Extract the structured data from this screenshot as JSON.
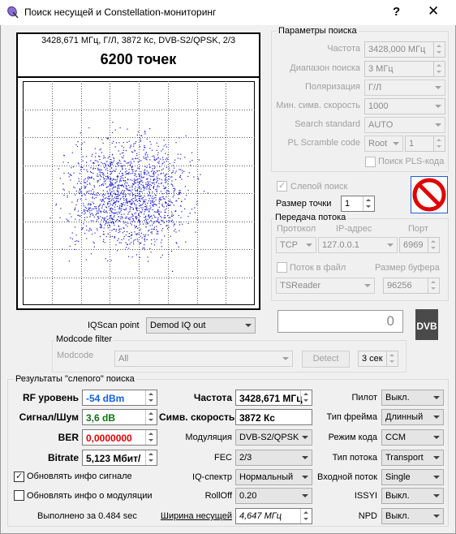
{
  "window": {
    "title": "Поиск несущей и Constellation-мониторинг",
    "help_label": "?",
    "close_label": "✕"
  },
  "plot": {
    "header": "3428,671 МГц, Г/Л, 3872 Кс, DVB-S2/QPSK, 2/3",
    "count": "6200 точек",
    "point_color": "#1a1ad0"
  },
  "search_params": {
    "title": "Параметры поиска",
    "frequency": {
      "label": "Частота",
      "value": "3428,000 МГц"
    },
    "range": {
      "label": "Диапазон поиска",
      "value": "3 МГц"
    },
    "polarization": {
      "label": "Поляризация",
      "value": "Г/Л"
    },
    "min_symrate": {
      "label": "Мин. симв. скорость",
      "value": "1000"
    },
    "standard": {
      "label": "Search standard",
      "value": "AUTO"
    },
    "pls": {
      "label": "PL Scramble code",
      "mode": "Root",
      "value": "1"
    },
    "pls_search": {
      "label": "Поиск PLS-кода",
      "checked": false
    }
  },
  "blind": {
    "label": "Слепой поиск",
    "checked": true,
    "point_size_label": "Размер точки",
    "point_size": "1"
  },
  "stream": {
    "title": "Передача потока",
    "protocol_label": "Протокол",
    "ip_label": "IP-адрес",
    "port_label": "Порт",
    "protocol": "TCP",
    "ip": "127.0.0.1",
    "port": "6969",
    "to_file": {
      "label": "Поток в файл",
      "checked": false
    },
    "buffer_label": "Размер буфера",
    "reader": "TSReader",
    "buffer": "96256"
  },
  "iq": {
    "label": "IQScan point",
    "value": "Demod IQ out",
    "counter": "0"
  },
  "modcode": {
    "title": "Modcode filter",
    "label": "Modcode",
    "value": "All",
    "detect": "Detect",
    "interval": "3 сек"
  },
  "results": {
    "title": "Результаты \"слепого\" поиска",
    "rf": {
      "label": "RF уровень",
      "value": "-54 dBm",
      "color": "#1060e0"
    },
    "snr": {
      "label": "Сигнал/Шум",
      "value": "3,6 dB",
      "color": "#107010"
    },
    "ber": {
      "label": "BER",
      "value": "0,0000000",
      "color": "#e00000"
    },
    "bitrate": {
      "label": "Bitrate",
      "value": "5,123 Мбит/"
    },
    "freq": {
      "label": "Частота",
      "value": "3428,671 МГц"
    },
    "symrate": {
      "label": "Симв. скорость",
      "value": "3872 Кс"
    },
    "modulation": {
      "label": "Модуляция",
      "value": "DVB-S2/QPSK"
    },
    "fec": {
      "label": "FEC",
      "value": "2/3"
    },
    "iq_spectrum": {
      "label": "IQ-спектр",
      "value": "Нормальный"
    },
    "rolloff": {
      "label": "RollOff",
      "value": "0.20"
    },
    "bandwidth": {
      "label": "Ширина несущей",
      "value": "4,647 МГц"
    },
    "pilot": {
      "label": "Пилот",
      "value": "Выкл."
    },
    "frame": {
      "label": "Тип фрейма",
      "value": "Длинный"
    },
    "code_mode": {
      "label": "Режим кода",
      "value": "CCM"
    },
    "stream_type": {
      "label": "Тип потока",
      "value": "Transport"
    },
    "input_stream": {
      "label": "Входной поток",
      "value": "Single"
    },
    "issyi": {
      "label": "ISSYI",
      "value": "Выкл."
    },
    "npd": {
      "label": "NPD",
      "value": "Выкл."
    },
    "update_signal": {
      "label": "Обновлять инфо сигнале",
      "checked": true
    },
    "update_mod": {
      "label": "Обновлять инфо о модуляции",
      "checked": false
    },
    "elapsed": "Выполнено за 0.484 sec"
  },
  "icons": {
    "app": "satellite-dish-icon",
    "stop": "no-entry-icon",
    "dvb": "dvb-logo"
  }
}
